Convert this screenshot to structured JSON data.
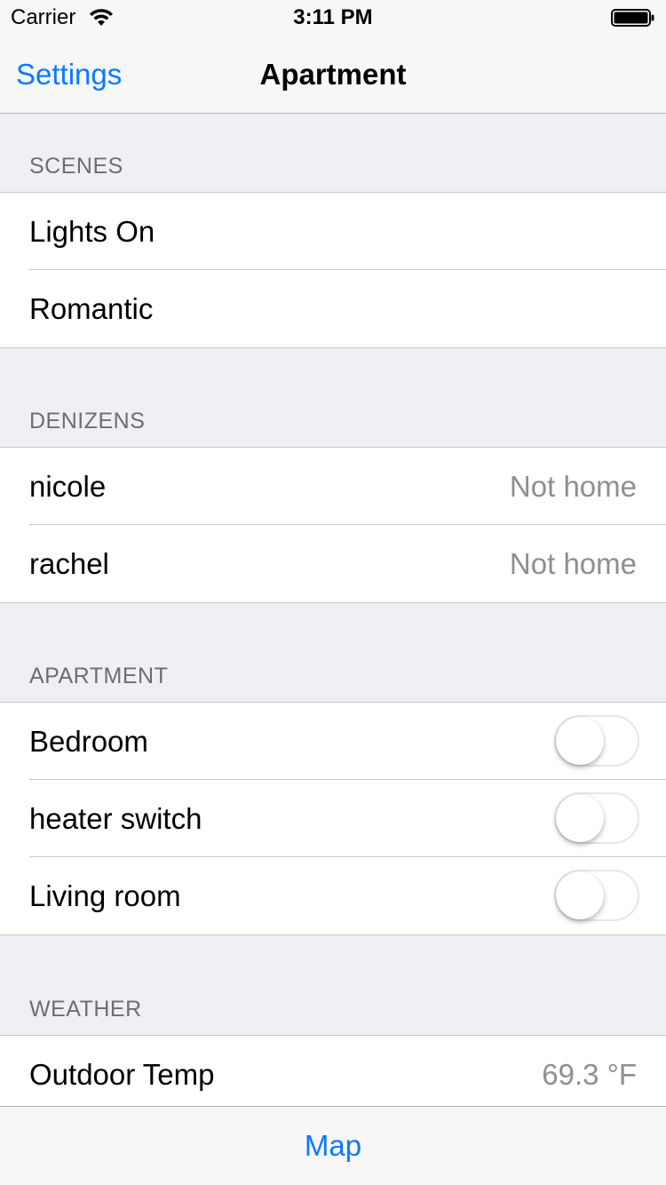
{
  "status_bar": {
    "carrier": "Carrier",
    "time": "3:11 PM",
    "wifi_icon": "wifi-icon",
    "battery_icon": "battery-full-icon"
  },
  "nav": {
    "back_label": "Settings",
    "title": "Apartment"
  },
  "sections": {
    "scenes": {
      "header": "SCENES",
      "rows": [
        {
          "label": "Lights On"
        },
        {
          "label": "Romantic"
        }
      ]
    },
    "denizens": {
      "header": "DENIZENS",
      "rows": [
        {
          "label": "nicole",
          "detail": "Not home"
        },
        {
          "label": "rachel",
          "detail": "Not home"
        }
      ]
    },
    "apartment": {
      "header": "APARTMENT",
      "rows": [
        {
          "label": "Bedroom",
          "on": false
        },
        {
          "label": "heater switch",
          "on": false
        },
        {
          "label": "Living room",
          "on": false
        }
      ]
    },
    "weather": {
      "header": "WEATHER",
      "rows": [
        {
          "label": "Outdoor Temp",
          "detail": "69.3 °F"
        }
      ]
    }
  },
  "tab_bar": {
    "label": "Map"
  },
  "colors": {
    "accent": "#0a7aff",
    "background": "#efeff4",
    "secondary_text": "#8e8e93",
    "header_text": "#6d6d72"
  }
}
